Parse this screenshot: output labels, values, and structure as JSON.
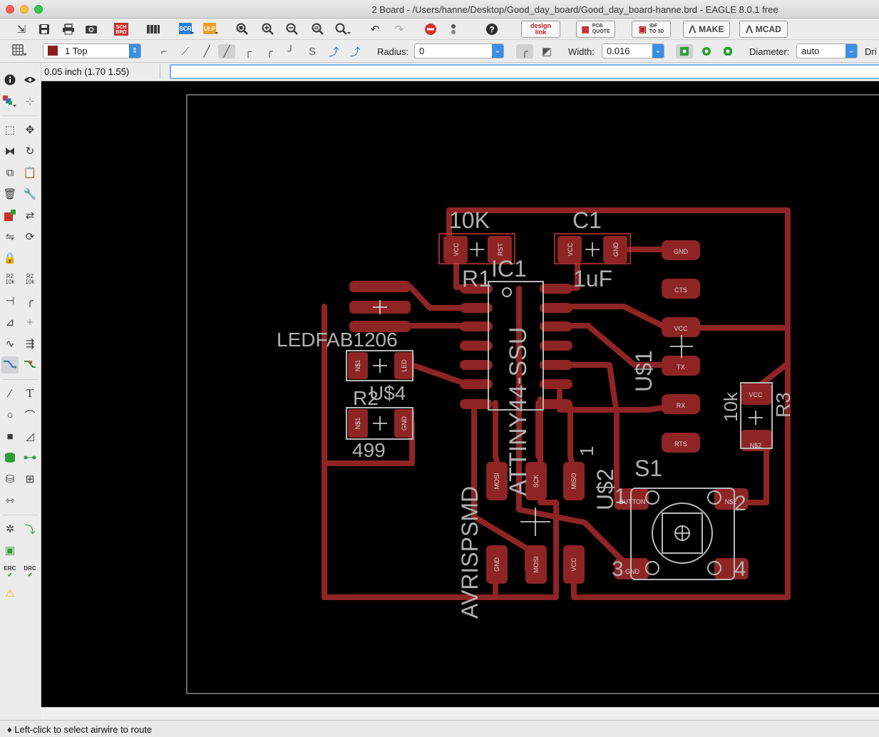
{
  "window": {
    "title": "2 Board - /Users/hanne/Desktop/Good_day_board/Good_day_board-hanne.brd - EAGLE 8.0.1 free"
  },
  "toolbar": {
    "design_link": [
      "design",
      "link"
    ],
    "pcb_quote": [
      "PCB",
      "QUOTE"
    ],
    "idf": [
      "IDF",
      "TO 3D"
    ],
    "make_label": "MAKE",
    "mcad_label": "MCAD",
    "sch_label": "SCH",
    "brd_label": "BRD",
    "scr_label": "SCR",
    "ulp_label": "ULP"
  },
  "params": {
    "layer_value": "1 Top",
    "layer_color": "#8b1c1c",
    "radius_label": "Radius:",
    "radius_value": "0",
    "width_label": "Width:",
    "width_value": "0.016",
    "diameter_label": "Diameter:",
    "diameter_value": "auto",
    "drill_label": "Dri"
  },
  "command": {
    "coordinates": "0.05 inch (1.70 1.55)",
    "input_value": ""
  },
  "palette": {
    "r2_a": "R2",
    "r2_b": "10k",
    "erc": "ERC",
    "drc": "DRC"
  },
  "board": {
    "colors": {
      "copper": "#8e2424",
      "silk": "#b8b8b8",
      "outline": "#c8c8c8",
      "background": "#000000"
    },
    "labels": {
      "r1_value": "10K",
      "r1_name": "R1",
      "c1_name": "C1",
      "c1_value": "1uF",
      "ic1_name": "IC1",
      "ic1_value": "ATTINY44-SSU",
      "led_value": "LEDFAB1206",
      "led_name": "U$4",
      "r2_name": "R2",
      "r2_value": "499",
      "ftdi_name": "U$1",
      "r3_value": "10k",
      "r3_name": "R3",
      "s1_name": "S1",
      "u2_name": "U$2",
      "isp_value": "AVRISPSMD",
      "isp_pin1": "1",
      "s1_p1": "1",
      "s1_p2": "2",
      "s1_p3": "3",
      "s1_p4": "4"
    },
    "pads": {
      "gnd": "GND",
      "cts": "CTS",
      "vcc": "VCC",
      "tx": "TX",
      "rx": "RX",
      "rts": "RTS",
      "r1_vcc": "VCC",
      "r1_rst": "RST",
      "c1_vcc": "VCC",
      "c1_gnd": "GND",
      "led_n1": "N$1",
      "led_n2": "LED",
      "r2_n1": "N$1",
      "r2_gnd": "GND",
      "r3_vcc": "VCC",
      "r3_n2": "N$2",
      "isp_sck": "SCK",
      "isp_miso": "MISO",
      "isp_mosi": "MOSI",
      "isp_gnd": "GND",
      "isp_vcc": "VCC",
      "isp_rst": "RST",
      "s1_button": "BUTTON",
      "s1_n2": "N$2",
      "s1_gnd": "GND"
    }
  },
  "status": {
    "message": "Left-click to select airwire to route"
  }
}
